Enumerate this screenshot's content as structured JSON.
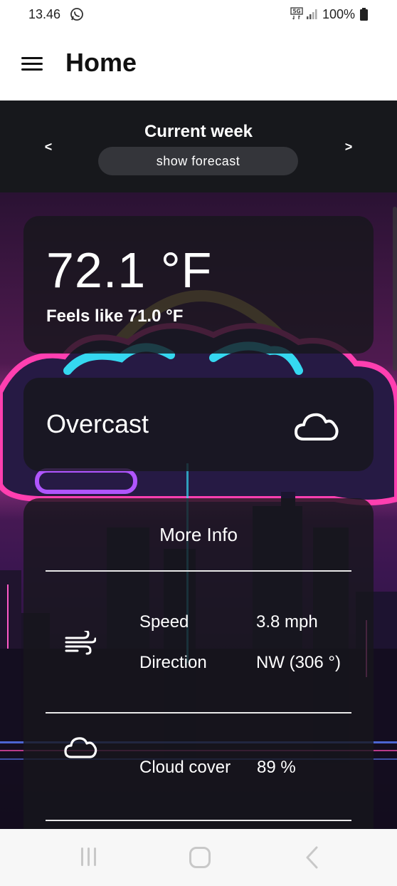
{
  "status_bar": {
    "time": "13.46",
    "network": "5G",
    "battery": "100%",
    "icons": [
      "whatsapp-icon",
      "5g-icon",
      "signal-icon",
      "battery-icon"
    ]
  },
  "app_bar": {
    "title": "Home",
    "menu_icon": "menu-icon"
  },
  "week_selector": {
    "prev_label": "<",
    "title": "Current week",
    "next_label": ">",
    "forecast_button": "show forecast"
  },
  "current": {
    "temperature": "72.1 °F",
    "feels_like": "Feels like 71.0 °F",
    "condition": "Overcast",
    "condition_icon": "cloud-icon"
  },
  "more_info": {
    "title": "More Info",
    "wind": {
      "icon": "wind-icon",
      "speed_label": "Speed",
      "speed_value": "3.8 mph",
      "direction_label": "Direction",
      "direction_value": "NW (306 °)"
    },
    "cloud": {
      "icon": "cloud-icon",
      "label": "Cloud cover",
      "value": "89 %"
    }
  },
  "nav_bar": {
    "icons": [
      "recents-icon",
      "home-icon",
      "back-icon"
    ]
  },
  "colors": {
    "app_bar_bg": "#ffffff",
    "week_bar_bg": "#17181c",
    "card_bg": "rgba(22,22,28,0.80)",
    "forecast_button_bg": "#34353a",
    "neon_pink": "#ff3fb0",
    "neon_cyan": "#35d8f0",
    "neon_yellow": "#f4d25a"
  }
}
